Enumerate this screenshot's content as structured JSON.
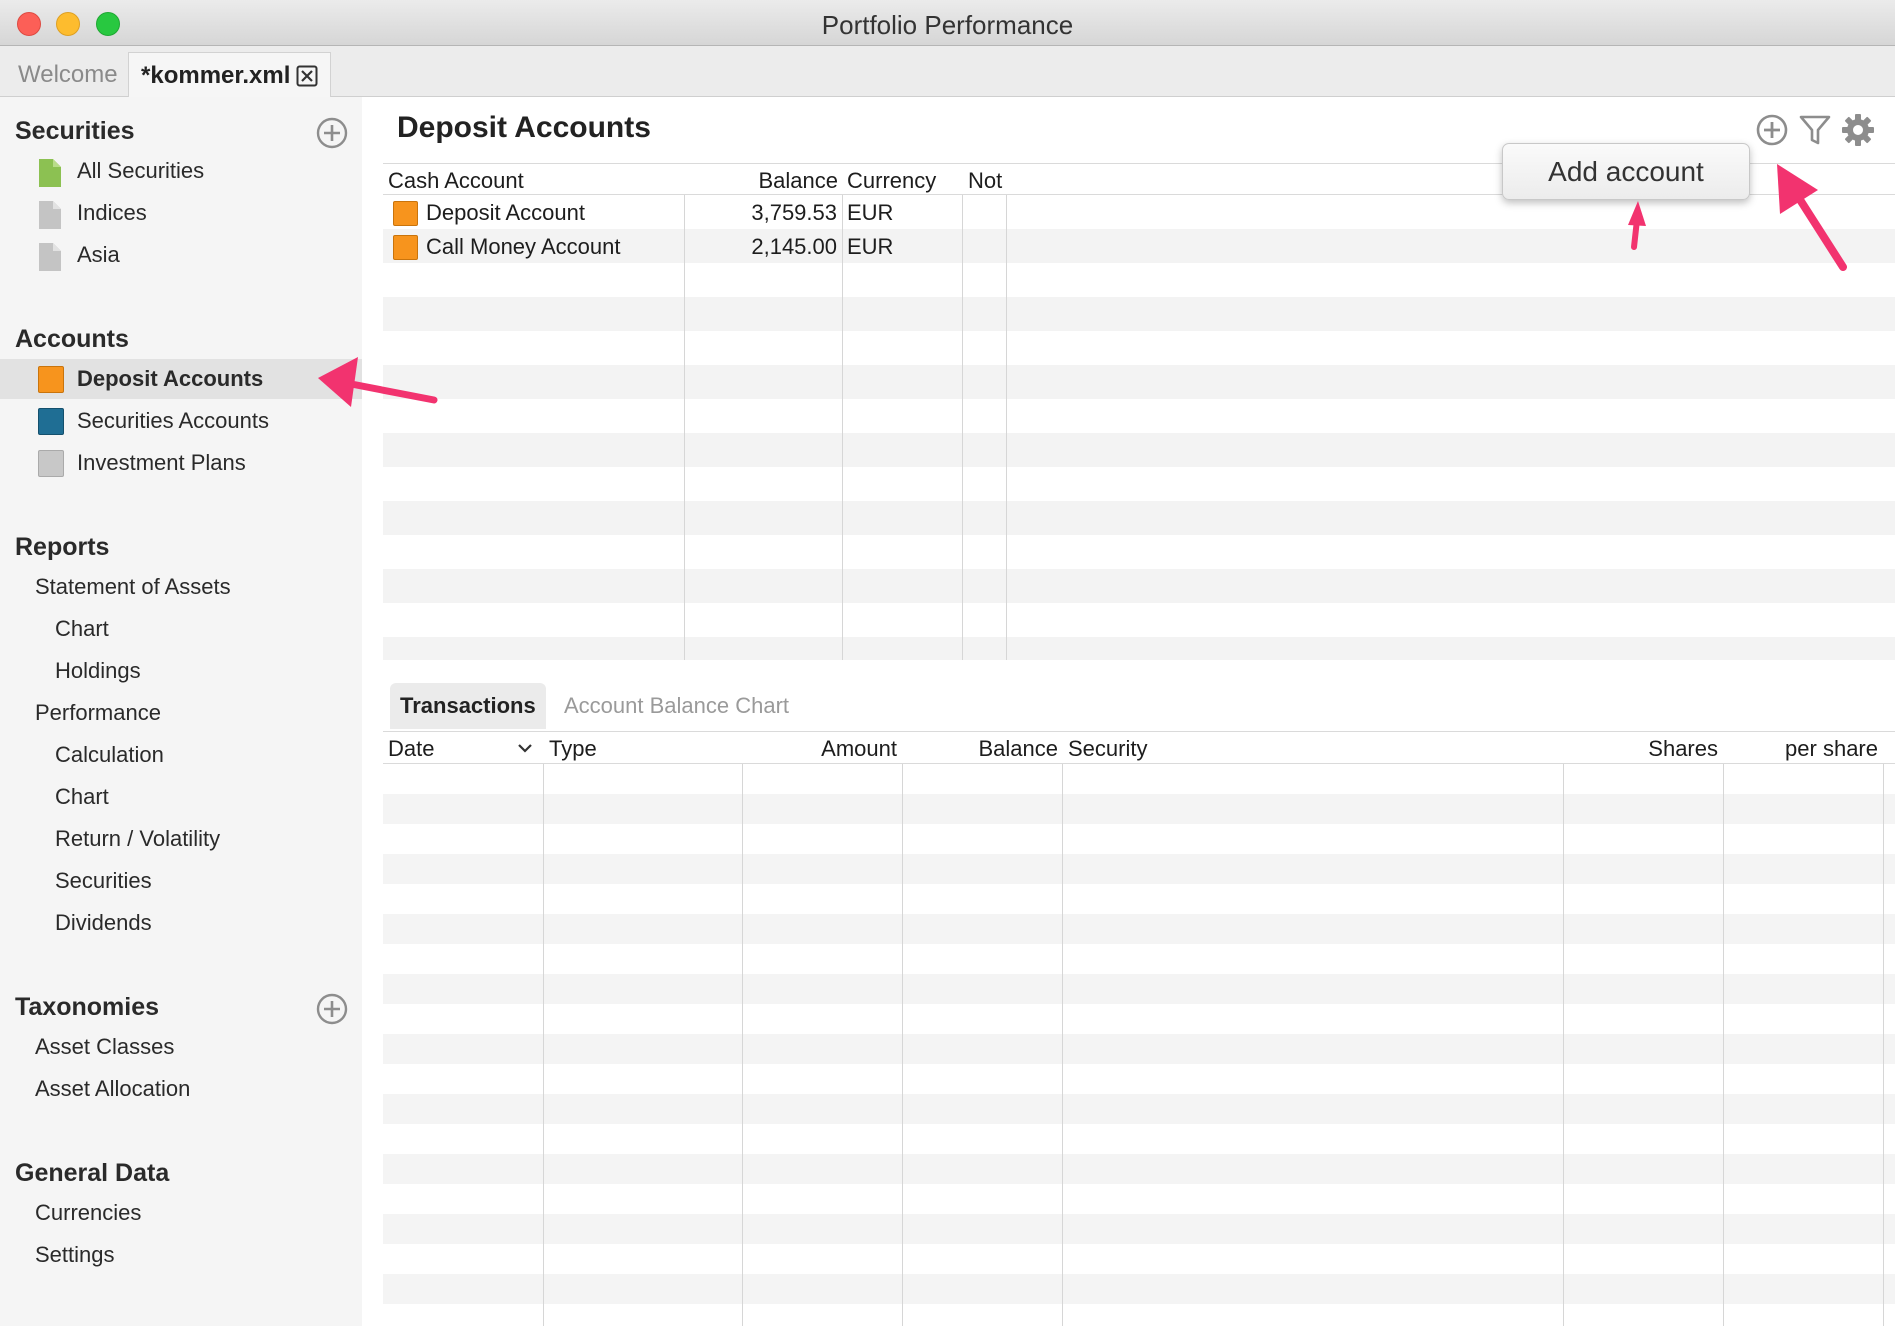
{
  "window": {
    "title": "Portfolio Performance"
  },
  "tabs": {
    "welcome": "Welcome",
    "file": "*kommer.xml"
  },
  "sidebar": {
    "securities": {
      "title": "Securities",
      "items": [
        "All Securities",
        "Indices",
        "Asia"
      ]
    },
    "accounts": {
      "title": "Accounts",
      "items": [
        "Deposit Accounts",
        "Securities Accounts",
        "Investment Plans"
      ]
    },
    "reports": {
      "title": "Reports",
      "items": [
        "Statement of Assets",
        "Chart",
        "Holdings",
        "Performance",
        "Calculation",
        "Chart",
        "Return / Volatility",
        "Securities",
        "Dividends"
      ]
    },
    "taxonomies": {
      "title": "Taxonomies",
      "items": [
        "Asset Classes",
        "Asset Allocation"
      ]
    },
    "general": {
      "title": "General Data",
      "items": [
        "Currencies",
        "Settings"
      ]
    }
  },
  "main": {
    "title": "Deposit Accounts",
    "toolbar": {
      "add_icon": "add-circle-icon",
      "filter_icon": "filter-icon",
      "settings_icon": "gear-icon"
    },
    "popup": "Add account",
    "accounts_table": {
      "columns": [
        "Cash Account",
        "Balance",
        "Currency",
        "Not"
      ],
      "rows": [
        {
          "name": "Deposit Account",
          "balance": "3,759.53",
          "currency": "EUR"
        },
        {
          "name": "Call Money Account",
          "balance": "2,145.00",
          "currency": "EUR"
        }
      ]
    },
    "subtabs": [
      "Transactions",
      "Account Balance Chart"
    ],
    "transactions_table": {
      "columns": [
        "Date",
        "Type",
        "Amount",
        "Balance",
        "Security",
        "Shares",
        "per share"
      ]
    }
  },
  "colors": {
    "accent_arrow": "#f2336f",
    "deposit_icon": "#f7941d",
    "securities_icon": "#1f6e94",
    "plans_icon": "#c8c8c8",
    "green_file": "#8cc152"
  }
}
